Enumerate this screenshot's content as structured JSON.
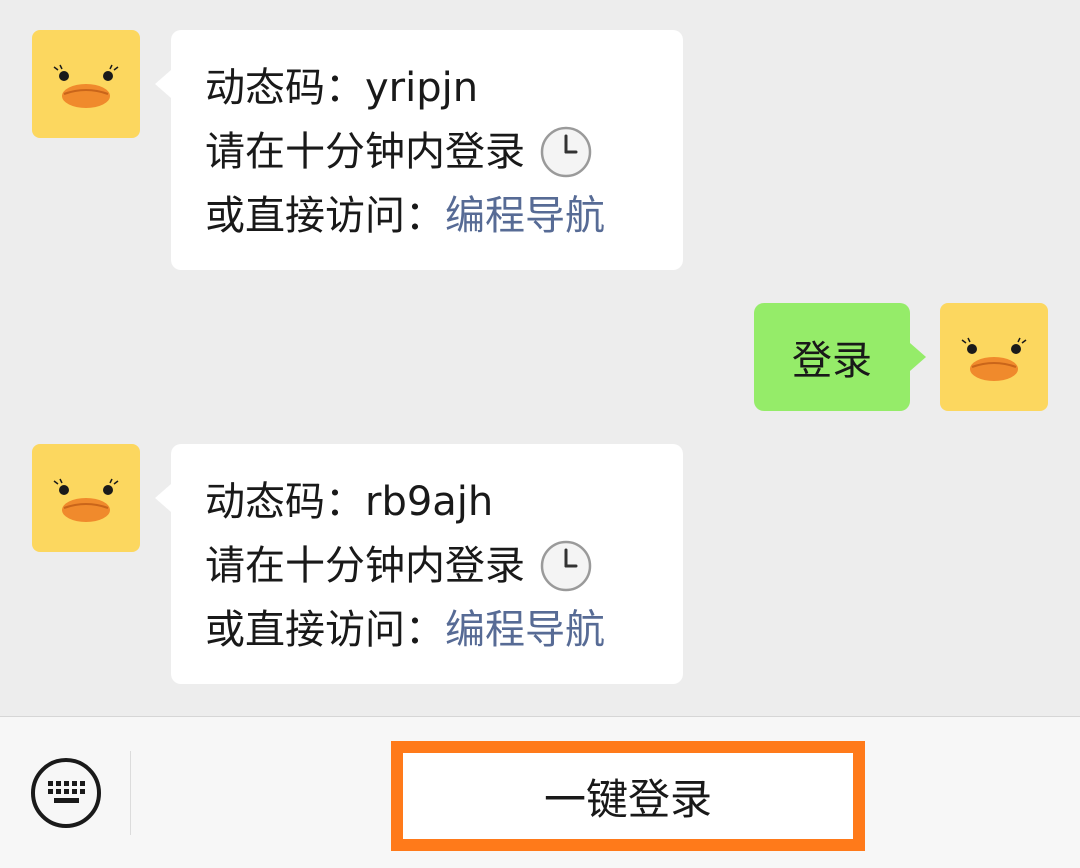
{
  "colors": {
    "background": "#ededed",
    "incoming_bubble": "#ffffff",
    "outgoing_bubble": "#95ec69",
    "link": "#576b95",
    "avatar": "#fcd75f",
    "highlight_border": "#ff7a1a"
  },
  "messages": [
    {
      "direction": "incoming",
      "avatar_icon": "duck-avatar-icon",
      "lines": {
        "code_label": "动态码：",
        "code_value": "yripjn",
        "expiry_text": "请在十分钟内登录",
        "expiry_icon": "clock-icon",
        "visit_label": "或直接访问：",
        "visit_link": "编程导航"
      }
    },
    {
      "direction": "outgoing",
      "avatar_icon": "duck-avatar-icon",
      "text": "登录"
    },
    {
      "direction": "incoming",
      "avatar_icon": "duck-avatar-icon",
      "lines": {
        "code_label": "动态码：",
        "code_value": "rb9ajh",
        "expiry_text": "请在十分钟内登录",
        "expiry_icon": "clock-icon",
        "visit_label": "或直接访问：",
        "visit_link": "编程导航"
      }
    }
  ],
  "bottom_bar": {
    "keyboard_icon": "keyboard-icon",
    "quick_login_label": "一键登录"
  }
}
